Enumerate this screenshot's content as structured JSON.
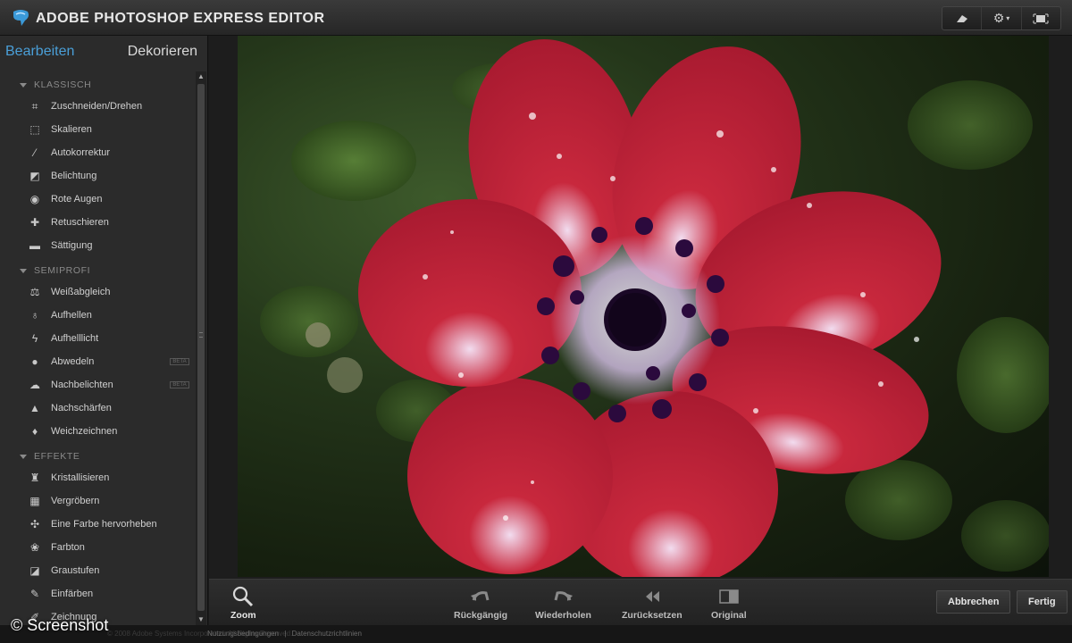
{
  "app": {
    "title": "ADOBE PHOTOSHOP EXPRESS EDITOR"
  },
  "sidebar": {
    "tabs": {
      "edit": "Bearbeiten",
      "decorate": "Dekorieren"
    },
    "sections": [
      {
        "label": "KLASSISCH",
        "tools": [
          {
            "label": "Zuschneiden/Drehen",
            "icon": "crop-icon"
          },
          {
            "label": "Skalieren",
            "icon": "resize-icon"
          },
          {
            "label": "Autokorrektur",
            "icon": "magic-wand-icon"
          },
          {
            "label": "Belichtung",
            "icon": "exposure-icon"
          },
          {
            "label": "Rote Augen",
            "icon": "eye-icon"
          },
          {
            "label": "Retuschieren",
            "icon": "bandage-icon"
          },
          {
            "label": "Sättigung",
            "icon": "saturation-icon"
          }
        ]
      },
      {
        "label": "SEMIPROFI",
        "tools": [
          {
            "label": "Weißabgleich",
            "icon": "balance-icon"
          },
          {
            "label": "Aufhellen",
            "icon": "bulb-icon"
          },
          {
            "label": "Aufhelllicht",
            "icon": "flash-icon"
          },
          {
            "label": "Abwedeln",
            "icon": "dodge-icon",
            "beta": "BETA"
          },
          {
            "label": "Nachbelichten",
            "icon": "burn-icon",
            "beta": "BETA"
          },
          {
            "label": "Nachschärfen",
            "icon": "sharpen-icon"
          },
          {
            "label": "Weichzeichnen",
            "icon": "blur-drop-icon"
          }
        ]
      },
      {
        "label": "EFFEKTE",
        "tools": [
          {
            "label": "Kristallisieren",
            "icon": "crystallize-icon"
          },
          {
            "label": "Vergröbern",
            "icon": "pixelate-icon"
          },
          {
            "label": "Eine Farbe hervorheben",
            "icon": "pop-color-icon"
          },
          {
            "label": "Farbton",
            "icon": "hue-icon"
          },
          {
            "label": "Graustufen",
            "icon": "grayscale-icon"
          },
          {
            "label": "Einfärben",
            "icon": "tint-icon"
          },
          {
            "label": "Zeichnung",
            "icon": "sketch-icon"
          }
        ]
      }
    ]
  },
  "bottom": {
    "zoom": "Zoom",
    "undo": "Rückgängig",
    "redo": "Wiederholen",
    "reset": "Zurücksetzen",
    "original": "Original",
    "cancel": "Abbrechen",
    "done": "Fertig"
  },
  "footer": {
    "copyright": "© 2008 Adobe Systems Incorporated. All Rights Reserved.",
    "terms": "Nutzungsbedingungen",
    "privacy": "Datenschutzrichtlinien",
    "separator": "|"
  },
  "watermark": "© Screenshot",
  "colors": {
    "accent": "#4a9fd8",
    "petal": "#c8283d",
    "center": "#2b0a3d"
  }
}
